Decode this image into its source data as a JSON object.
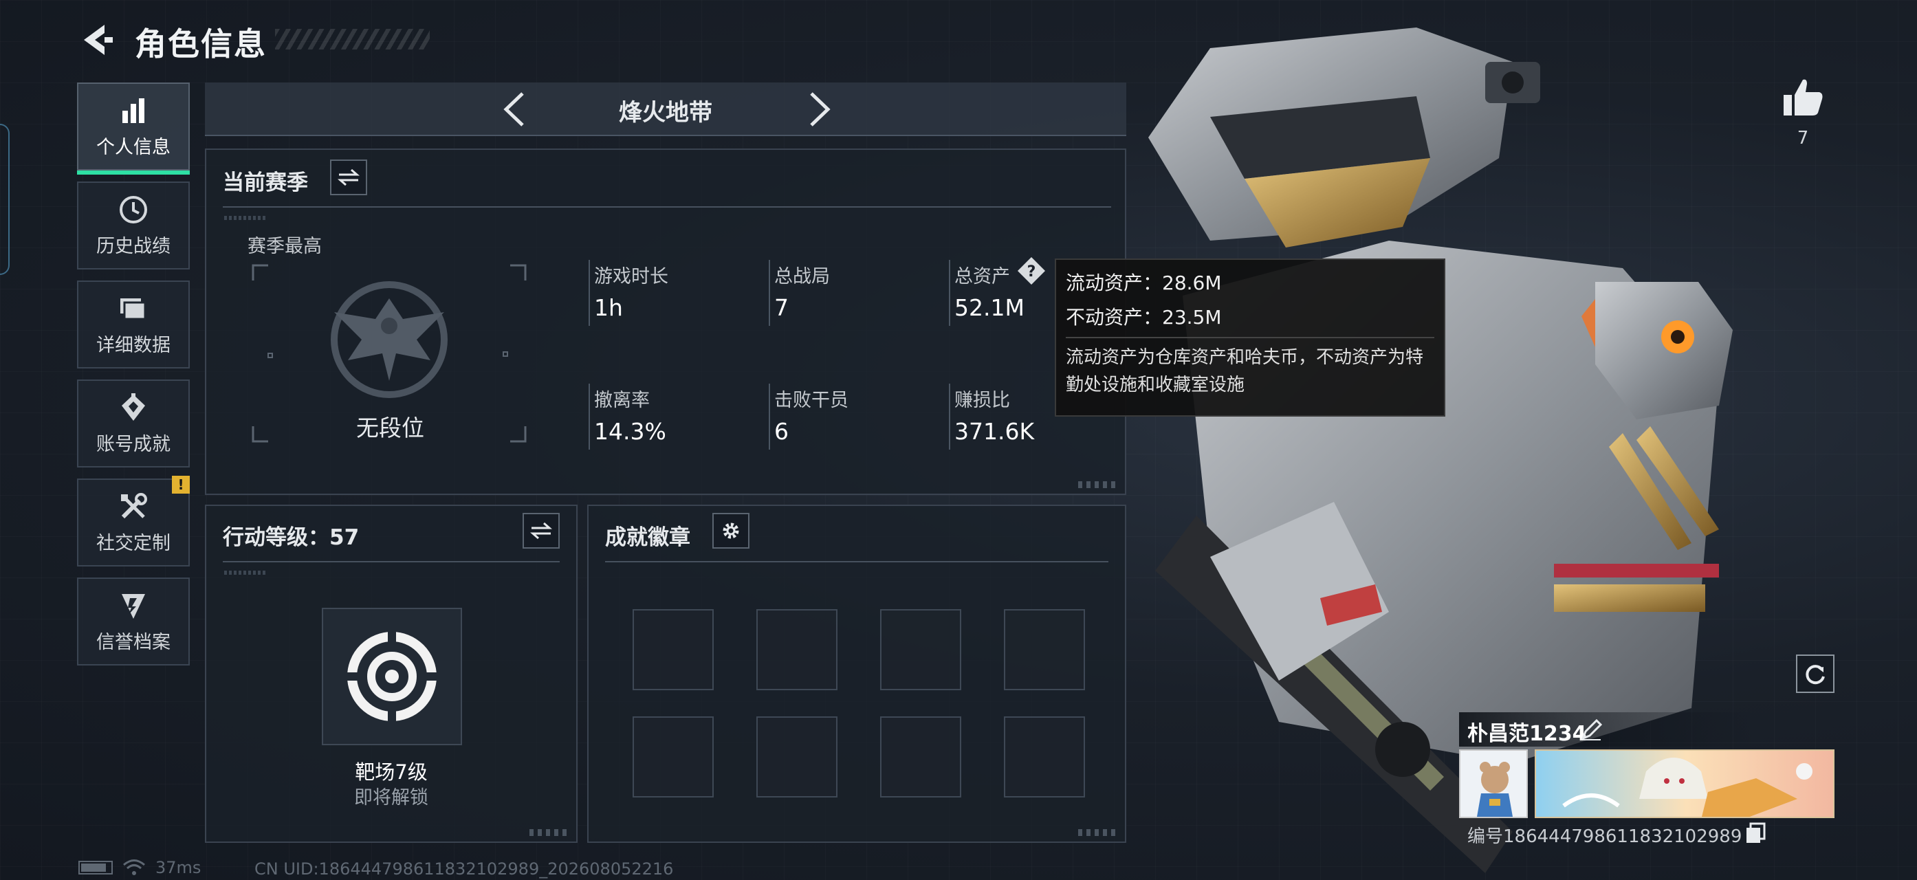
{
  "header": {
    "title": "角色信息"
  },
  "sidebar": {
    "items": [
      {
        "label": "个人信息",
        "icon": "bar-chart-icon",
        "active": true
      },
      {
        "label": "历史战绩",
        "icon": "clock-icon"
      },
      {
        "label": "详细数据",
        "icon": "folder-icon"
      },
      {
        "label": "账号成就",
        "icon": "achievement-icon"
      },
      {
        "label": "社交定制",
        "icon": "tools-icon",
        "badge": "!"
      },
      {
        "label": "信誉档案",
        "icon": "credit-icon"
      }
    ]
  },
  "mode_selector": {
    "title": "烽火地带"
  },
  "season": {
    "title": "当前赛季",
    "best_label": "赛季最高",
    "rank": "无段位",
    "stats": [
      {
        "label": "游戏时长",
        "value": "1h"
      },
      {
        "label": "总战局",
        "value": "7"
      },
      {
        "label": "总资产",
        "value": "52.1M"
      },
      {
        "label": "撤离率",
        "value": "14.3%"
      },
      {
        "label": "击败干员",
        "value": "6"
      },
      {
        "label": "赚损比",
        "value": "371.6K"
      }
    ]
  },
  "tooltip": {
    "liquid": "流动资产：28.6M",
    "fixed": "不动资产：23.5M",
    "description": "流动资产为仓库资产和哈夫币，不动资产为特勤处设施和收藏室设施"
  },
  "level": {
    "title": "行动等级：57",
    "name": "靶场7级",
    "status": "即将解锁"
  },
  "badges": {
    "title": "成就徽章"
  },
  "likes": {
    "count": "7"
  },
  "player": {
    "name": "朴昌范1234",
    "id": "编号1864447986118321029​89"
  },
  "footer": {
    "ping": "37ms",
    "uid": "CN UID:1864447986118321029​89_202608052216"
  },
  "colors": {
    "accent": "#2ee0a4",
    "badge": "#e3b230"
  }
}
